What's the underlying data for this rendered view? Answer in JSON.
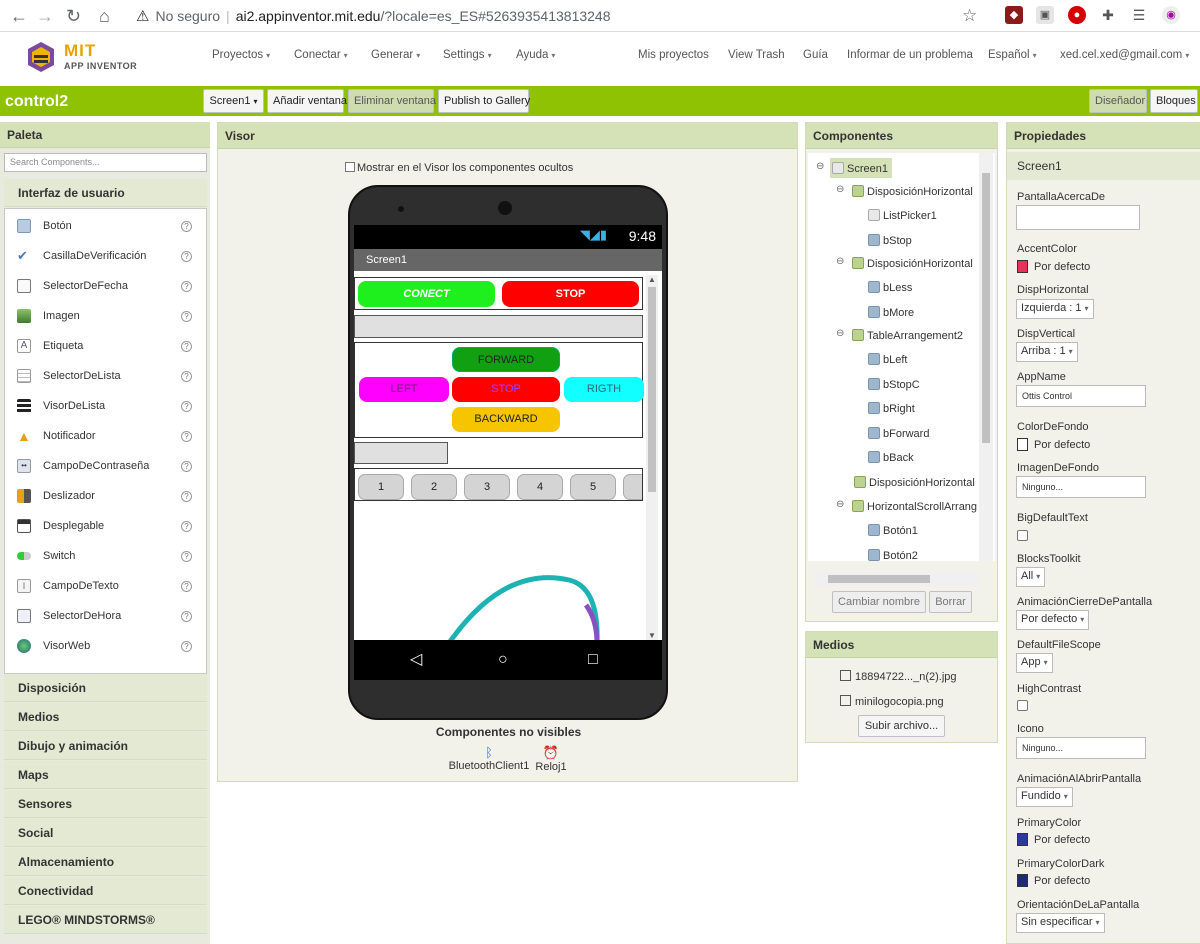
{
  "browser": {
    "not_secure": "No seguro",
    "separator": "|",
    "domain": "ai2.appinventor.mit.edu",
    "path": "/?locale=es_ES#5263935413813248"
  },
  "header": {
    "logo_mit": "MIT",
    "logo_ai": "APP INVENTOR",
    "menu": [
      "Proyectos",
      "Conectar",
      "Generar",
      "Settings",
      "Ayuda"
    ],
    "right_menu": [
      "Mis proyectos",
      "View Trash",
      "Guía",
      "Informar de un problema",
      "Español",
      "xed.cel.xed@gmail.com"
    ]
  },
  "toolbar": {
    "project_name": "control2",
    "screen_select": "Screen1",
    "add_screen": "Añadir ventana",
    "remove_screen": "Eliminar ventana",
    "publish": "Publish to Gallery",
    "designer": "Diseñador",
    "blocks": "Bloques"
  },
  "palette": {
    "title": "Paleta",
    "search_placeholder": "Search Components...",
    "open_category": "Interfaz de usuario",
    "items": [
      "Botón",
      "CasillaDeVerificación",
      "SelectorDeFecha",
      "Imagen",
      "Etiqueta",
      "SelectorDeLista",
      "VisorDeLista",
      "Notificador",
      "CampoDeContraseña",
      "Deslizador",
      "Desplegable",
      "Switch",
      "CampoDeTexto",
      "SelectorDeHora",
      "VisorWeb"
    ],
    "help": "?",
    "categories": [
      "Disposición",
      "Medios",
      "Dibujo y animación",
      "Maps",
      "Sensores",
      "Social",
      "Almacenamiento",
      "Conectividad",
      "LEGO® MINDSTORMS®"
    ]
  },
  "viewer": {
    "title": "Visor",
    "show_hidden": "Mostrar en el Visor los componentes ocultos",
    "time": "9:48",
    "screen_title": "Screen1",
    "btn_conect": "CONECT",
    "btn_stop_top": "STOP",
    "btn_forward": "FORWARD",
    "btn_left": "LEFT",
    "btn_stop_mid": "STOP",
    "btn_right": "RIGTH",
    "btn_backward": "BACKWARD",
    "num_buttons": [
      "1",
      "2",
      "3",
      "4",
      "5"
    ],
    "nonvisible_title": "Componentes no visibles",
    "nonvisible": [
      "BluetoothClient1",
      "Reloj1"
    ]
  },
  "components": {
    "title": "Componentes",
    "tree": [
      "Screen1",
      "DisposiciónHorizontal",
      "ListPicker1",
      "bStop",
      "DisposiciónHorizontal",
      "bLess",
      "bMore",
      "TableArrangement2",
      "bLeft",
      "bStopC",
      "bRight",
      "bForward",
      "bBack",
      "DisposiciónHorizontal",
      "HorizontalScrollArrang",
      "Botón1",
      "Botón2"
    ],
    "rename": "Cambiar nombre",
    "delete": "Borrar"
  },
  "media": {
    "title": "Medios",
    "files": [
      "18894722..._n(2).jpg",
      "minilogocopia.png"
    ],
    "upload": "Subir archivo..."
  },
  "properties": {
    "title": "Propiedades",
    "component": "Screen1",
    "about_label": "PantallaAcercaDe",
    "accent_label": "AccentColor",
    "accent_value": "Por defecto",
    "accent_color": "#e8325a",
    "halign_label": "DispHorizontal",
    "halign_value": "Izquierda : 1",
    "valign_label": "DispVertical",
    "valign_value": "Arriba : 1",
    "appname_label": "AppName",
    "appname_value": "Ottis Control",
    "bg_label": "ColorDeFondo",
    "bg_value": "Por defecto",
    "bgimg_label": "ImagenDeFondo",
    "bgimg_value": "Ninguno...",
    "bigtext_label": "BigDefaultText",
    "toolkit_label": "BlocksToolkit",
    "toolkit_value": "All",
    "close_anim_label": "AnimaciónCierreDePantalla",
    "close_anim_value": "Por defecto",
    "filescope_label": "DefaultFileScope",
    "filescope_value": "App",
    "contrast_label": "HighContrast",
    "icon_label": "Icono",
    "icon_value": "Ninguno...",
    "open_anim_label": "AnimaciónAlAbrirPantalla",
    "open_anim_value": "Fundido",
    "primary_label": "PrimaryColor",
    "primary_value": "Por defecto",
    "primary_color": "#2b3a99",
    "primarydark_label": "PrimaryColorDark",
    "primarydark_value": "Por defecto",
    "primarydark_color": "#1d2a7a",
    "orientation_label": "OrientaciónDeLaPantalla",
    "orientation_value": "Sin especificar"
  }
}
